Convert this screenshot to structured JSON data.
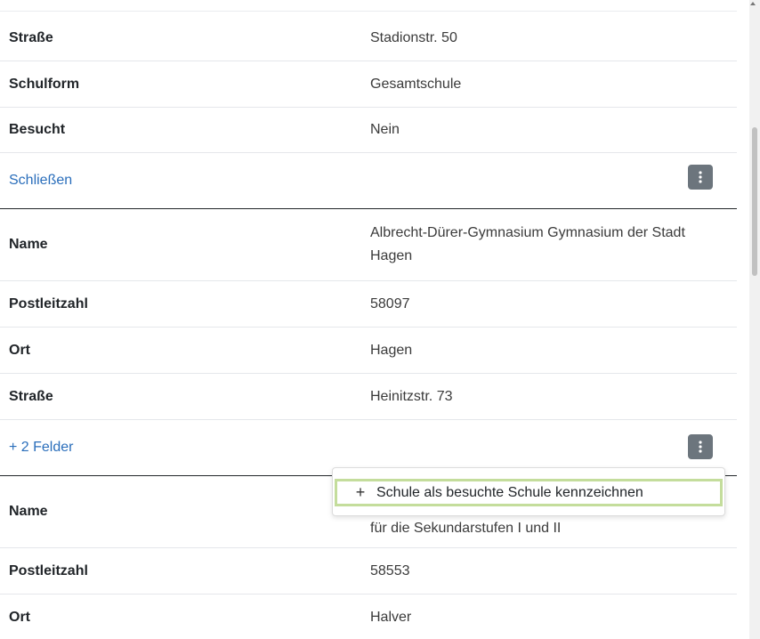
{
  "colors": {
    "link": "#2a6ebb",
    "menu_button": "#6c757d",
    "highlight_border": "#c4dd9c"
  },
  "block1": {
    "rows": [
      {
        "label": "Straße",
        "value": "Stadionstr. 50"
      },
      {
        "label": "Schulform",
        "value": "Gesamtschule"
      },
      {
        "label": "Besucht",
        "value": "Nein"
      }
    ],
    "footer_link": "Schließen"
  },
  "block2": {
    "rows": [
      {
        "label": "Name",
        "value": "Albrecht-Dürer-Gymnasium Gymnasium der Stadt Hagen"
      },
      {
        "label": "Postleitzahl",
        "value": "58097"
      },
      {
        "label": "Ort",
        "value": "Hagen"
      },
      {
        "label": "Straße",
        "value": "Heinitzstr. 73"
      }
    ],
    "footer_link": "+ 2 Felder"
  },
  "block3": {
    "rows": [
      {
        "label": "Name",
        "value": "für die Sekundarstufen I und II"
      },
      {
        "label": "Postleitzahl",
        "value": "58553"
      },
      {
        "label": "Ort",
        "value": "Halver"
      }
    ]
  },
  "dropdown": {
    "icon": "plus-icon",
    "icon_glyph": "+",
    "item_label": "Schule als besuchte Schule kennzeichnen"
  }
}
